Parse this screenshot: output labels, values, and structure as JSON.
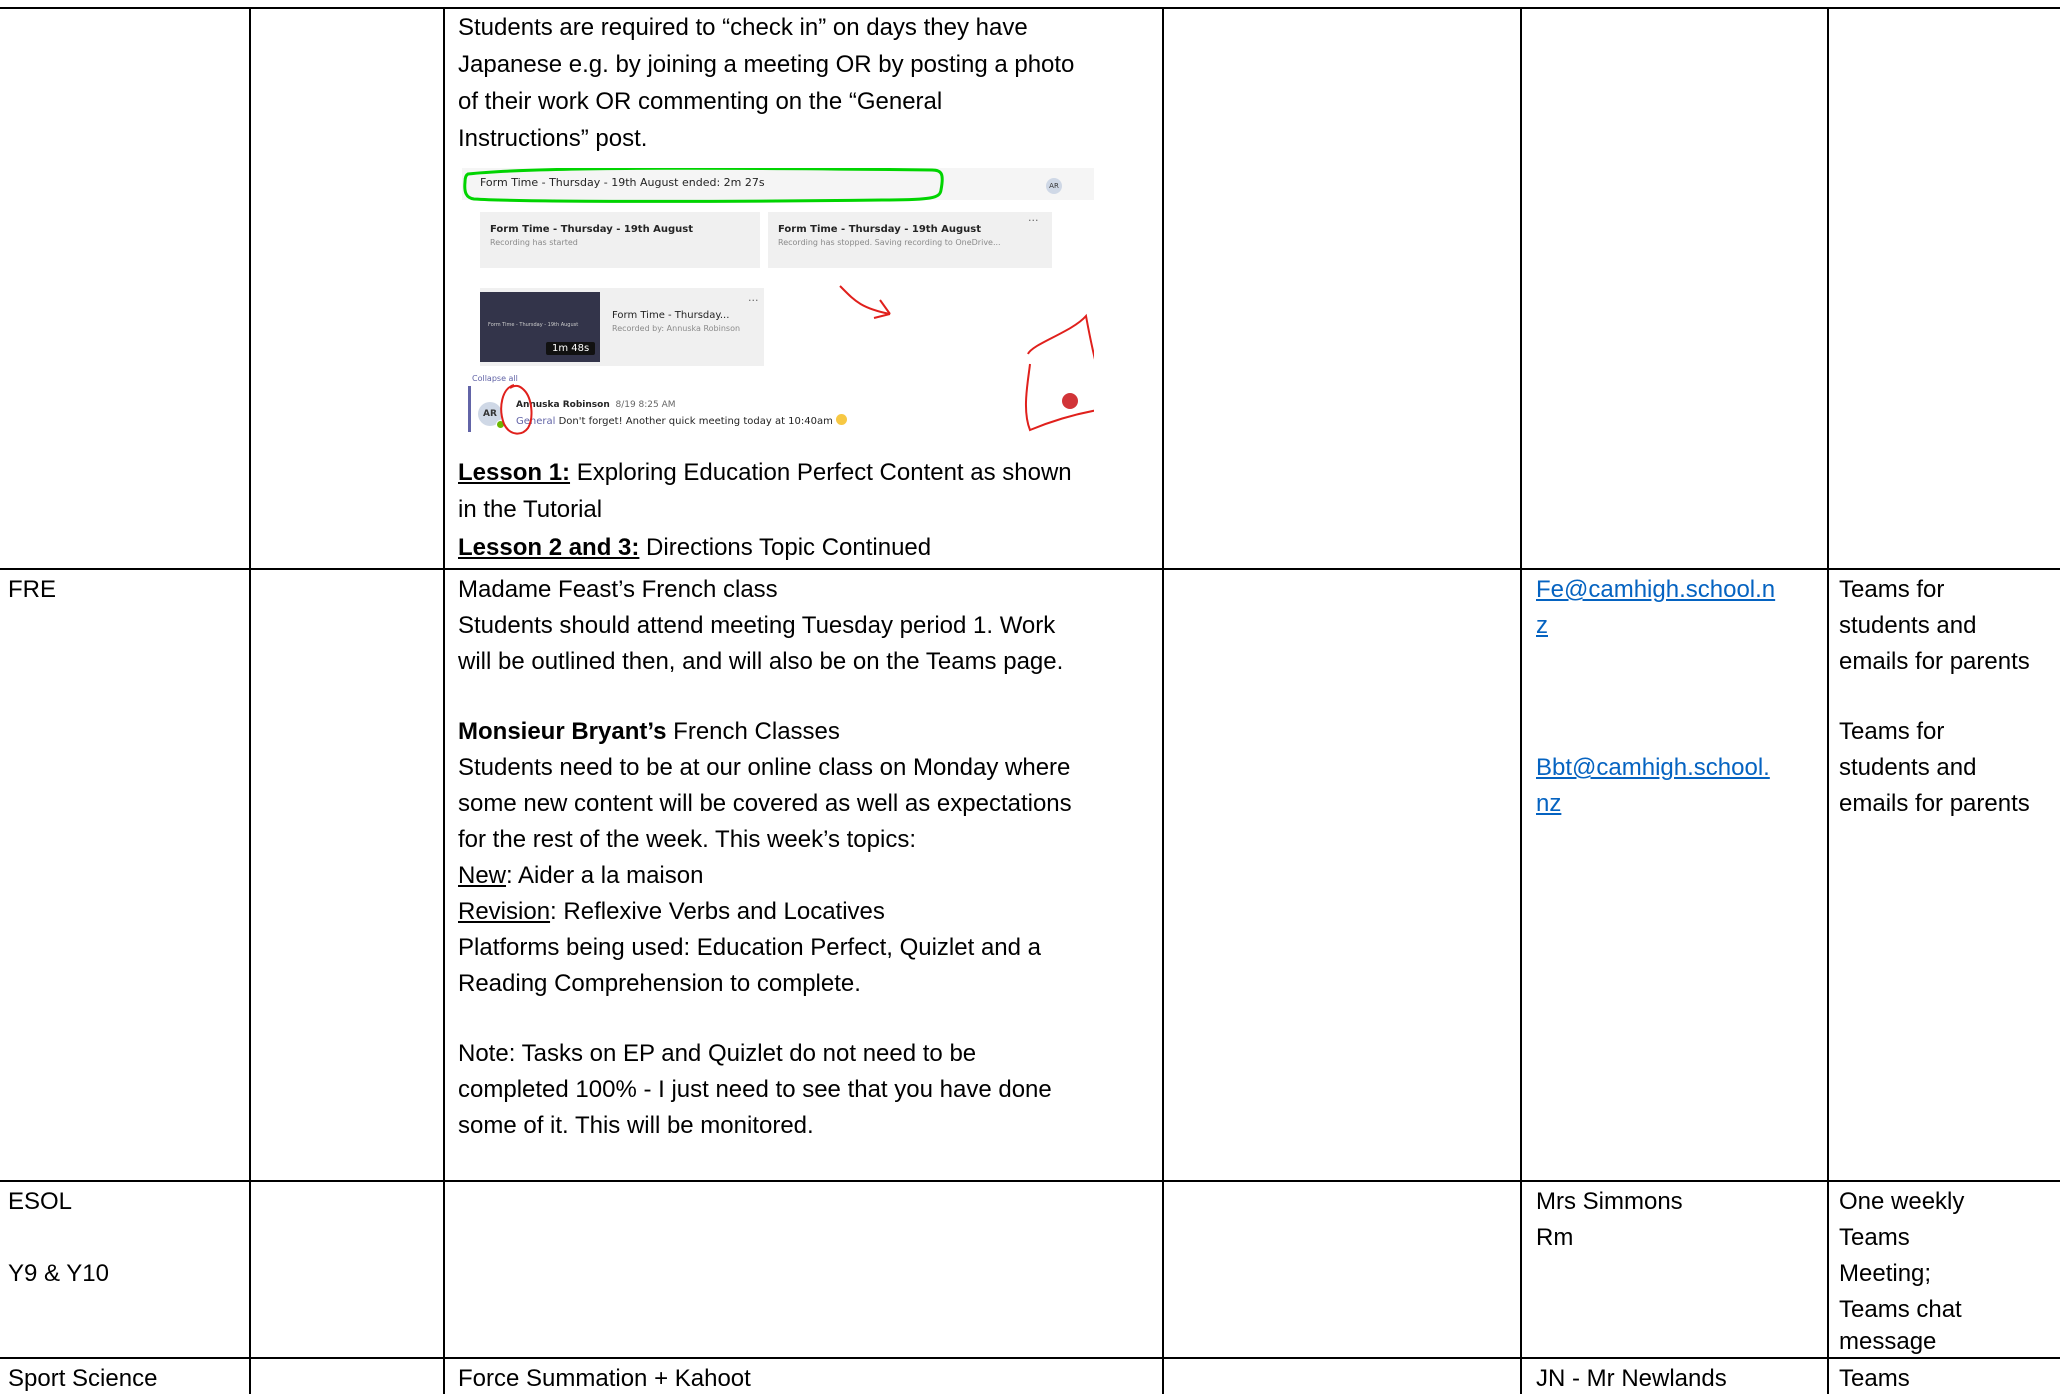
{
  "rows": {
    "jpn": {
      "paragraph_lines": [
        "Students are required to “check in” on days they have",
        "Japanese e.g. by joining a meeting OR by posting a photo",
        "of their work OR commenting on the “General",
        "Instructions” post."
      ],
      "lesson1_label": "Lesson 1:",
      "lesson1_text": " Exploring Education Perfect Content as shown",
      "lesson1_text2": "in the Tutorial",
      "lesson23_label": "Lesson 2 and 3:",
      "lesson23_text": " Directions Topic Continued",
      "screenshot": {
        "header_title": "Form Time - Thursday - 19th August ended: 2m 27s",
        "header_avatar": "AR",
        "card1_title": "Form Time - Thursday - 19th August",
        "card1_sub": "Recording has started",
        "card2_title": "Form Time - Thursday - 19th August",
        "card2_sub": "Recording has stopped. Saving recording to OneDrive...",
        "card2_menu": "···",
        "rec_title": "Form Time - Thursday...",
        "rec_sub": "Recorded by: Annuska Robinson",
        "rec_menu": "···",
        "thumb_title": "Form Time - Thursday - 19th August",
        "duration": "1m 48s",
        "collapse": "Collapse all",
        "author": "Annuska Robinson",
        "timestamp": "8/19 8:25 AM",
        "channel": "General",
        "message": " Don't forget! Another quick meeting today at 10:40am",
        "avatar": "AR",
        "emoji_icon": "smiley-emoji-icon",
        "annotation_colors": {
          "highlight": "#00d400",
          "ink": "#e0201c"
        }
      }
    },
    "fre": {
      "subject": "FRE",
      "line1": "Madame Feast’s French class",
      "line2": "Students should attend meeting Tuesday period 1.  Work",
      "line3": "will be outlined then, and will also be on the Teams page.",
      "bryant_bold": "Monsieur Bryant’s",
      "bryant_rest": " French Classes",
      "line5": "Students need to be at our online class on Monday where",
      "line6": "some new content will be covered as well as expectations",
      "line7": "for the rest of the week. This week’s topics:",
      "new_label": "New",
      "new_text": ": Aider a la maison",
      "revision_label": "Revision",
      "revision_text": ": Reflexive Verbs and Locatives",
      "line10": "Platforms being used: Education Perfect, Quizlet and a",
      "line11": "Reading Comprehension to complete.",
      "note1": "Note: Tasks on EP and Quizlet do not need to be",
      "note2": "completed 100% - I just need to see that you have done",
      "note3": "some of it. This will be monitored.",
      "email1_part1": "Fe@camhigh.school.n",
      "email1_part2": "z",
      "email2_part1": "Bbt@camhigh.school.",
      "email2_part2": "nz",
      "comm1": [
        "Teams for",
        "students and",
        "emails for parents"
      ],
      "comm2": [
        "Teams for",
        "students and",
        "emails for parents"
      ]
    },
    "esol": {
      "subject": "ESOL",
      "years": "Y9 & Y10",
      "contact1": "Mrs Simmons",
      "contact2": "Rm",
      "comm": [
        "One weekly",
        "Teams",
        "Meeting;",
        "Teams chat",
        "message"
      ]
    },
    "sport": {
      "subject": "Sport Science",
      "work": "Force Summation + Kahoot",
      "contact": "JN - Mr Newlands",
      "comm": "Teams"
    }
  }
}
